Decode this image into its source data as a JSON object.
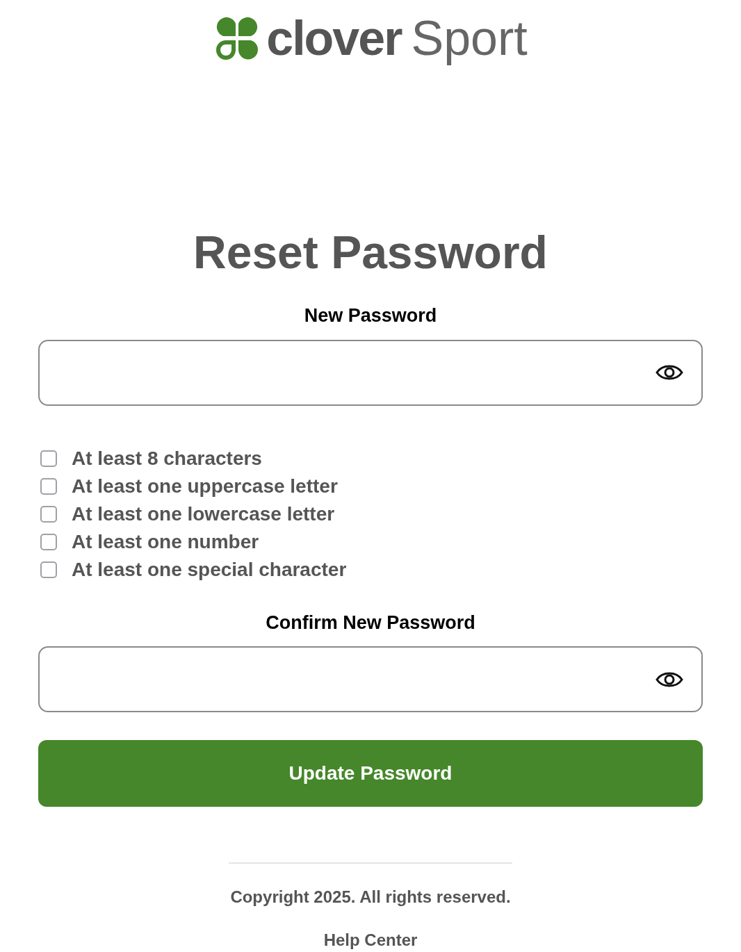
{
  "logo": {
    "word": "clover",
    "suffix": "Sport"
  },
  "title": "Reset Password",
  "new_password": {
    "label": "New Password"
  },
  "requirements": [
    {
      "label": "At least 8 characters",
      "checked": false
    },
    {
      "label": "At least one uppercase letter",
      "checked": false
    },
    {
      "label": "At least one lowercase letter",
      "checked": false
    },
    {
      "label": "At least one number",
      "checked": false
    },
    {
      "label": "At least one special character",
      "checked": false
    }
  ],
  "confirm_password": {
    "label": "Confirm New Password"
  },
  "submit": "Update Password",
  "footer": {
    "copyright": "Copyright 2025. All rights reserved.",
    "link": "Help Center"
  }
}
